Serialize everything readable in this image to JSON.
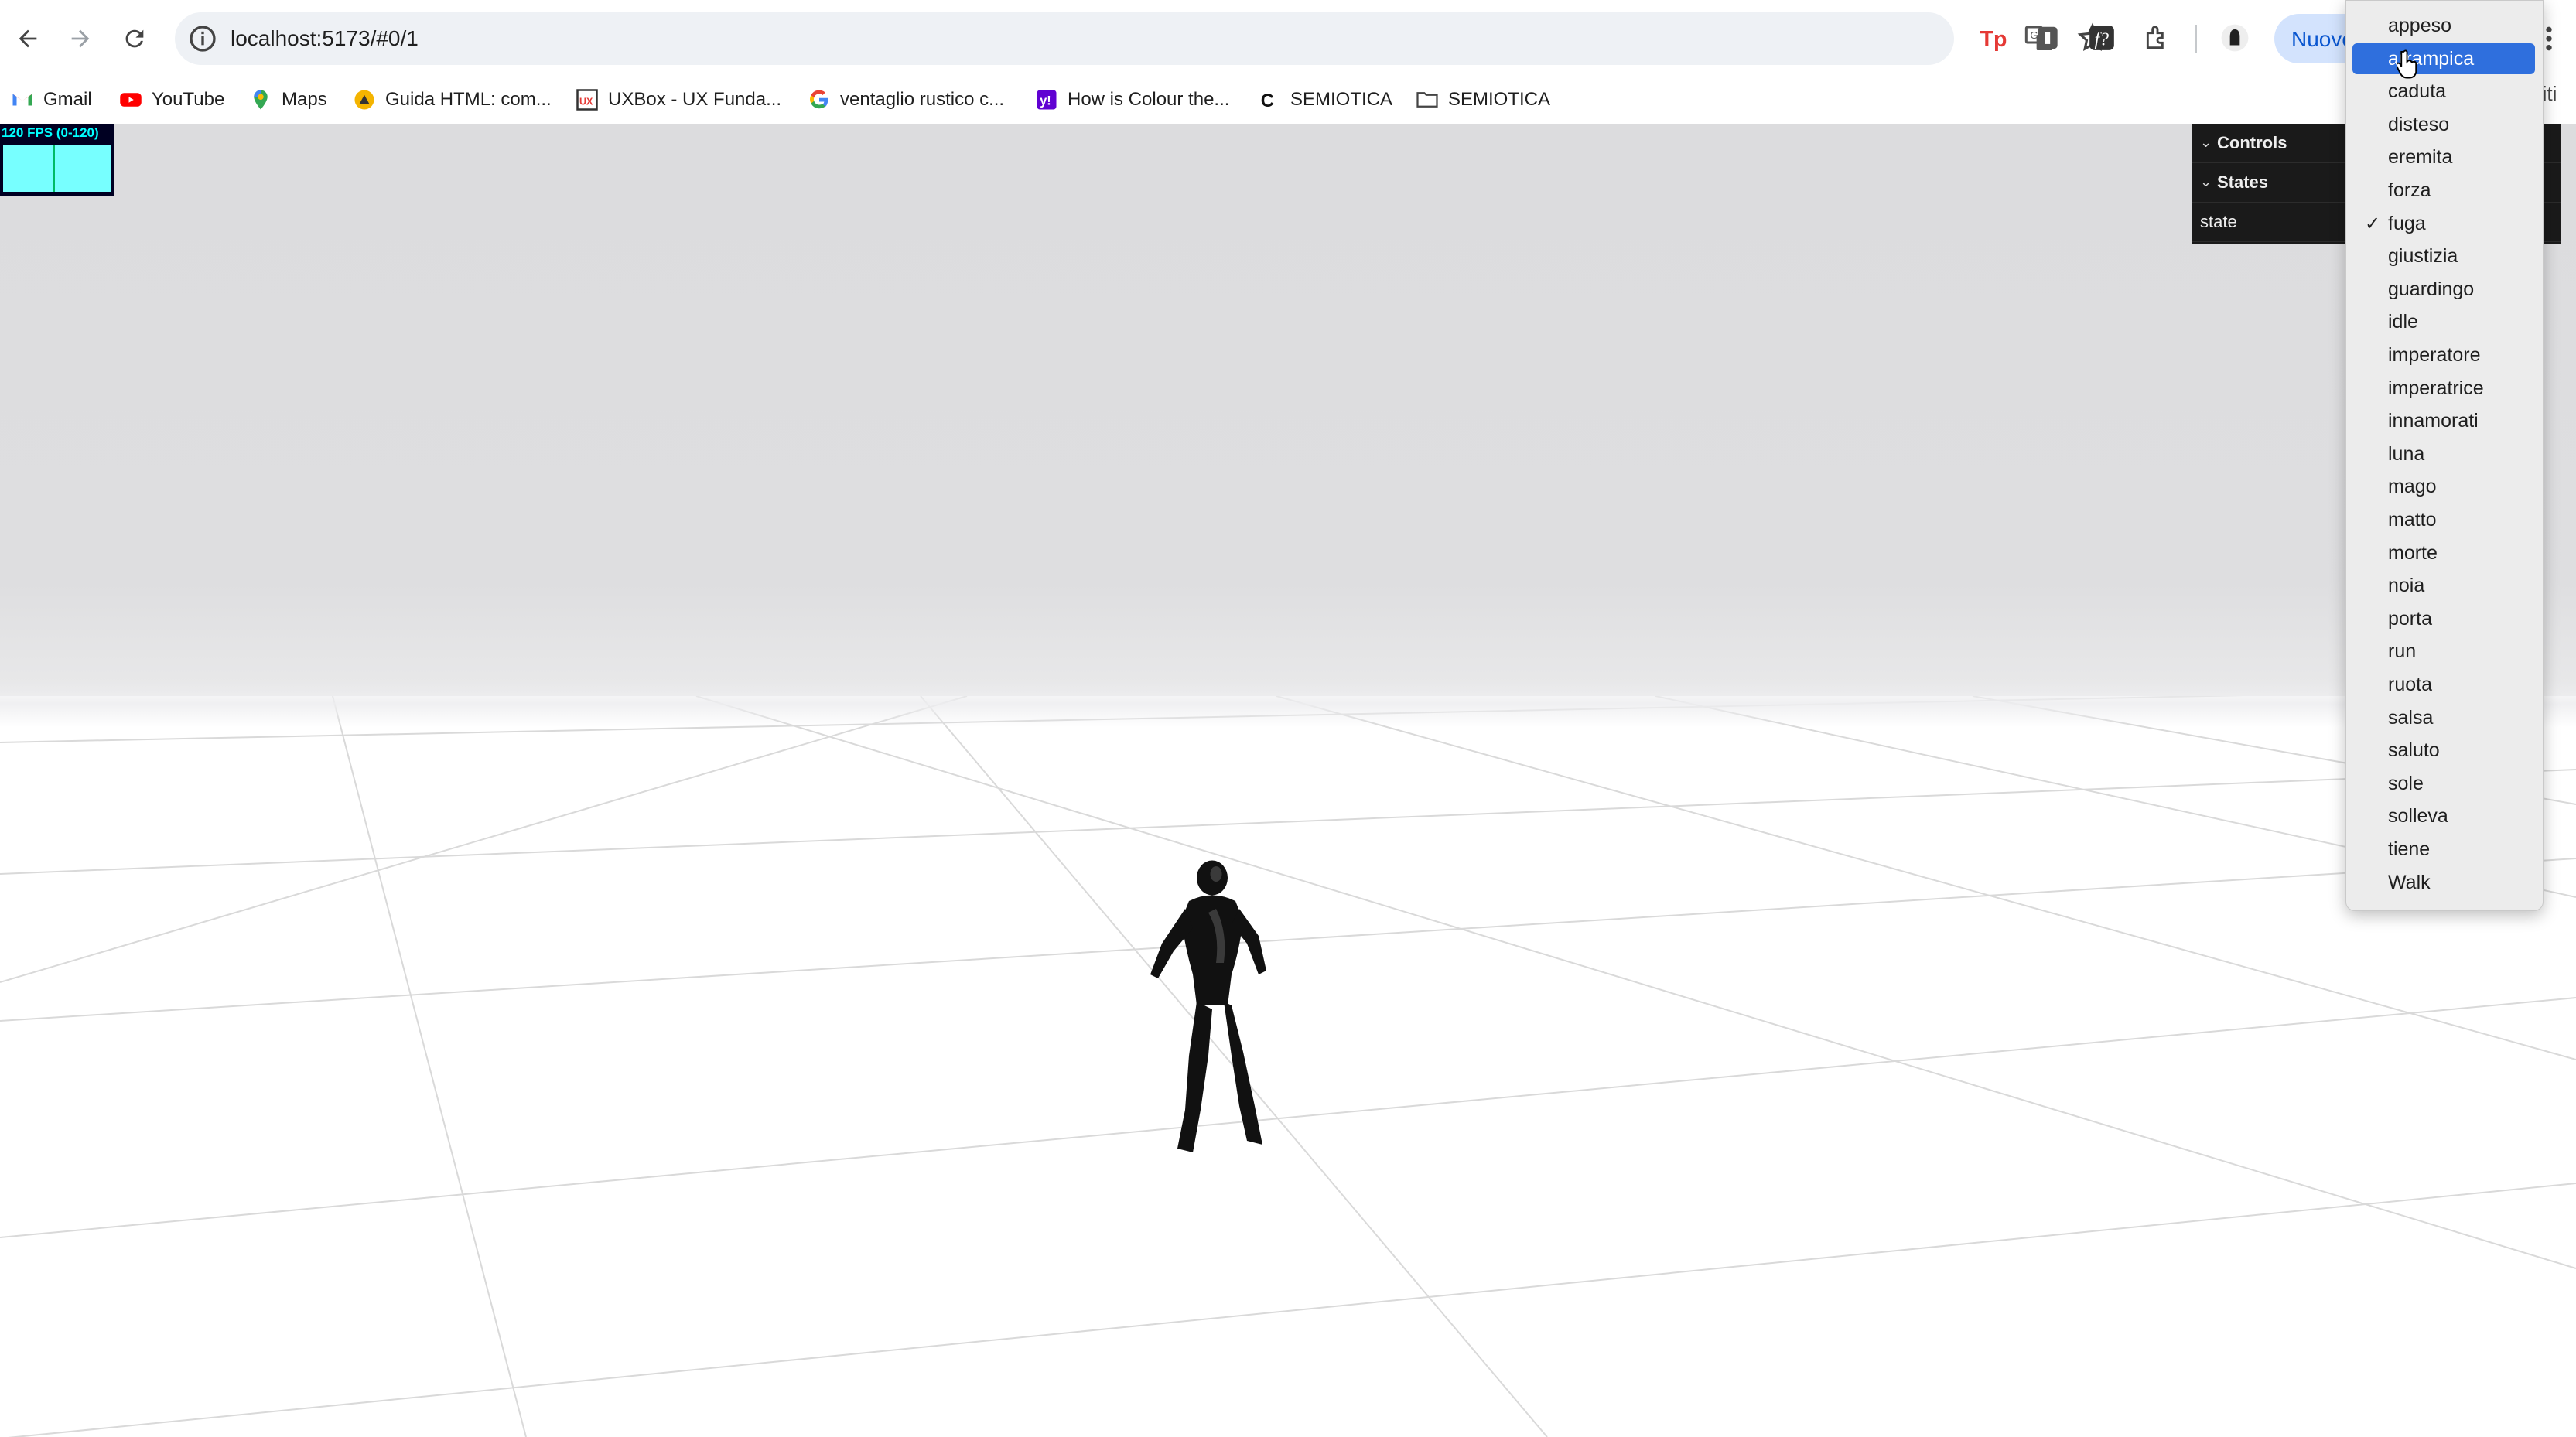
{
  "browser": {
    "url": "localhost:5173/#0/1",
    "profile_button_label": "Nuovo",
    "partial_right_label": "riti"
  },
  "bookmarks": [
    {
      "label": "Gmail",
      "icon": "gmail-icon"
    },
    {
      "label": "YouTube",
      "icon": "youtube-icon"
    },
    {
      "label": "Maps",
      "icon": "maps-icon"
    },
    {
      "label": "Guida HTML: com...",
      "icon": "html-guide-icon"
    },
    {
      "label": "UXBox - UX Funda...",
      "icon": "uxbox-icon"
    },
    {
      "label": "ventaglio rustico c...",
      "icon": "google-icon"
    },
    {
      "label": "How is Colour the...",
      "icon": "yahoo-icon"
    },
    {
      "label": "SEMIOTICA",
      "icon": "semiotica-c-icon"
    },
    {
      "label": "SEMIOTICA",
      "icon": "folder-icon"
    }
  ],
  "stats": {
    "fps_label": "120 FPS (0-120)"
  },
  "gui": {
    "controls_label": "Controls",
    "states_label": "States",
    "state_label": "state"
  },
  "dropdown": {
    "selected_value": "fuga",
    "highlighted": "arrampica",
    "options": [
      "appeso",
      "arrampica",
      "caduta",
      "disteso",
      "eremita",
      "forza",
      "fuga",
      "giustizia",
      "guardingo",
      "idle",
      "imperatore",
      "imperatrice",
      "innamorati",
      "luna",
      "mago",
      "matto",
      "morte",
      "noia",
      "porta",
      "run",
      "ruota",
      "salsa",
      "saluto",
      "sole",
      "solleva",
      "tiene",
      "Walk"
    ]
  },
  "colors": {
    "dropdown_highlight": "#2f6fdd",
    "gui_background": "#1a1a1a",
    "fps_graph": "#77ffff",
    "profile_chip": "#d3e3fd"
  }
}
